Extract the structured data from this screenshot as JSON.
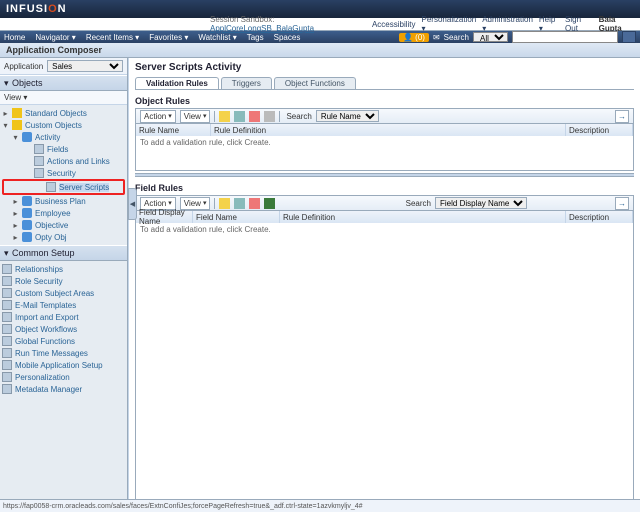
{
  "brand": {
    "name_a": "INFUSI",
    "name_b": "O",
    "name_c": "N",
    "sub": ""
  },
  "top": {
    "session": "Session Sandbox:",
    "session_link": "ApplCoreLongSB_BalaGupta",
    "accessibility": "Accessibility",
    "personalization": "Personalization ▾",
    "administration": "Administration ▾",
    "help": "Help ▾",
    "signout": "Sign Out",
    "user": "Bala Gupta"
  },
  "nav": {
    "home": "Home",
    "navigator": "Navigator ▾",
    "recent": "Recent Items ▾",
    "favorites": "Favorites ▾",
    "watchlist": "Watchlist ▾",
    "tags": "Tags",
    "spaces": "Spaces",
    "notify": "(0)",
    "search_label": "Search",
    "search_scope": "All",
    "go": "→"
  },
  "app": {
    "title": "Application Composer",
    "label": "Application",
    "selected": "Sales"
  },
  "objects": {
    "header": "Objects",
    "view": "View ▾",
    "standard": "Standard Objects",
    "custom": "Custom Objects",
    "activity": "Activity",
    "fields": "Fields",
    "actions": "Actions and Links",
    "security": "Security",
    "server_scripts": "Server Scripts",
    "bp": "Business Plan",
    "employee": "Employee",
    "objective": "Objective",
    "opty": "Opty Obj"
  },
  "common": {
    "header": "Common Setup",
    "relationships": "Relationships",
    "role_security": "Role Security",
    "csa": "Custom Subject Areas",
    "email": "E-Mail Templates",
    "impexp": "Import and Export",
    "owf": "Object Workflows",
    "gf": "Global Functions",
    "rtm": "Run Time Messages",
    "mas": "Mobile Application Setup",
    "pers": "Personalization",
    "mm": "Metadata Manager"
  },
  "page": {
    "title": "Server Scripts Activity",
    "tabs": {
      "validation": "Validation Rules",
      "triggers": "Triggers",
      "object_fn": "Object Functions"
    }
  },
  "obj_rules": {
    "header": "Object Rules",
    "action": "Action",
    "view": "View",
    "search": "Search",
    "search_by": "Rule Name",
    "cols": {
      "rule_name": "Rule Name",
      "rule_def": "Rule Definition",
      "desc": "Description"
    },
    "hint": "To add a validation rule, click Create."
  },
  "field_rules": {
    "header": "Field Rules",
    "action": "Action",
    "view": "View",
    "search": "Search",
    "search_by": "Field Display Name",
    "cols": {
      "fdn": "Field Display Name",
      "fn": "Field Name",
      "rule_def": "Rule Definition",
      "desc": "Description"
    },
    "hint": "To add a validation rule, click Create."
  },
  "status": "https://fap0058-crm.oracleads.com/sales/faces/ExtnConfiJes;forcePageRefresh=true&_adf.ctrl-state=1azvkmyljv_4#"
}
